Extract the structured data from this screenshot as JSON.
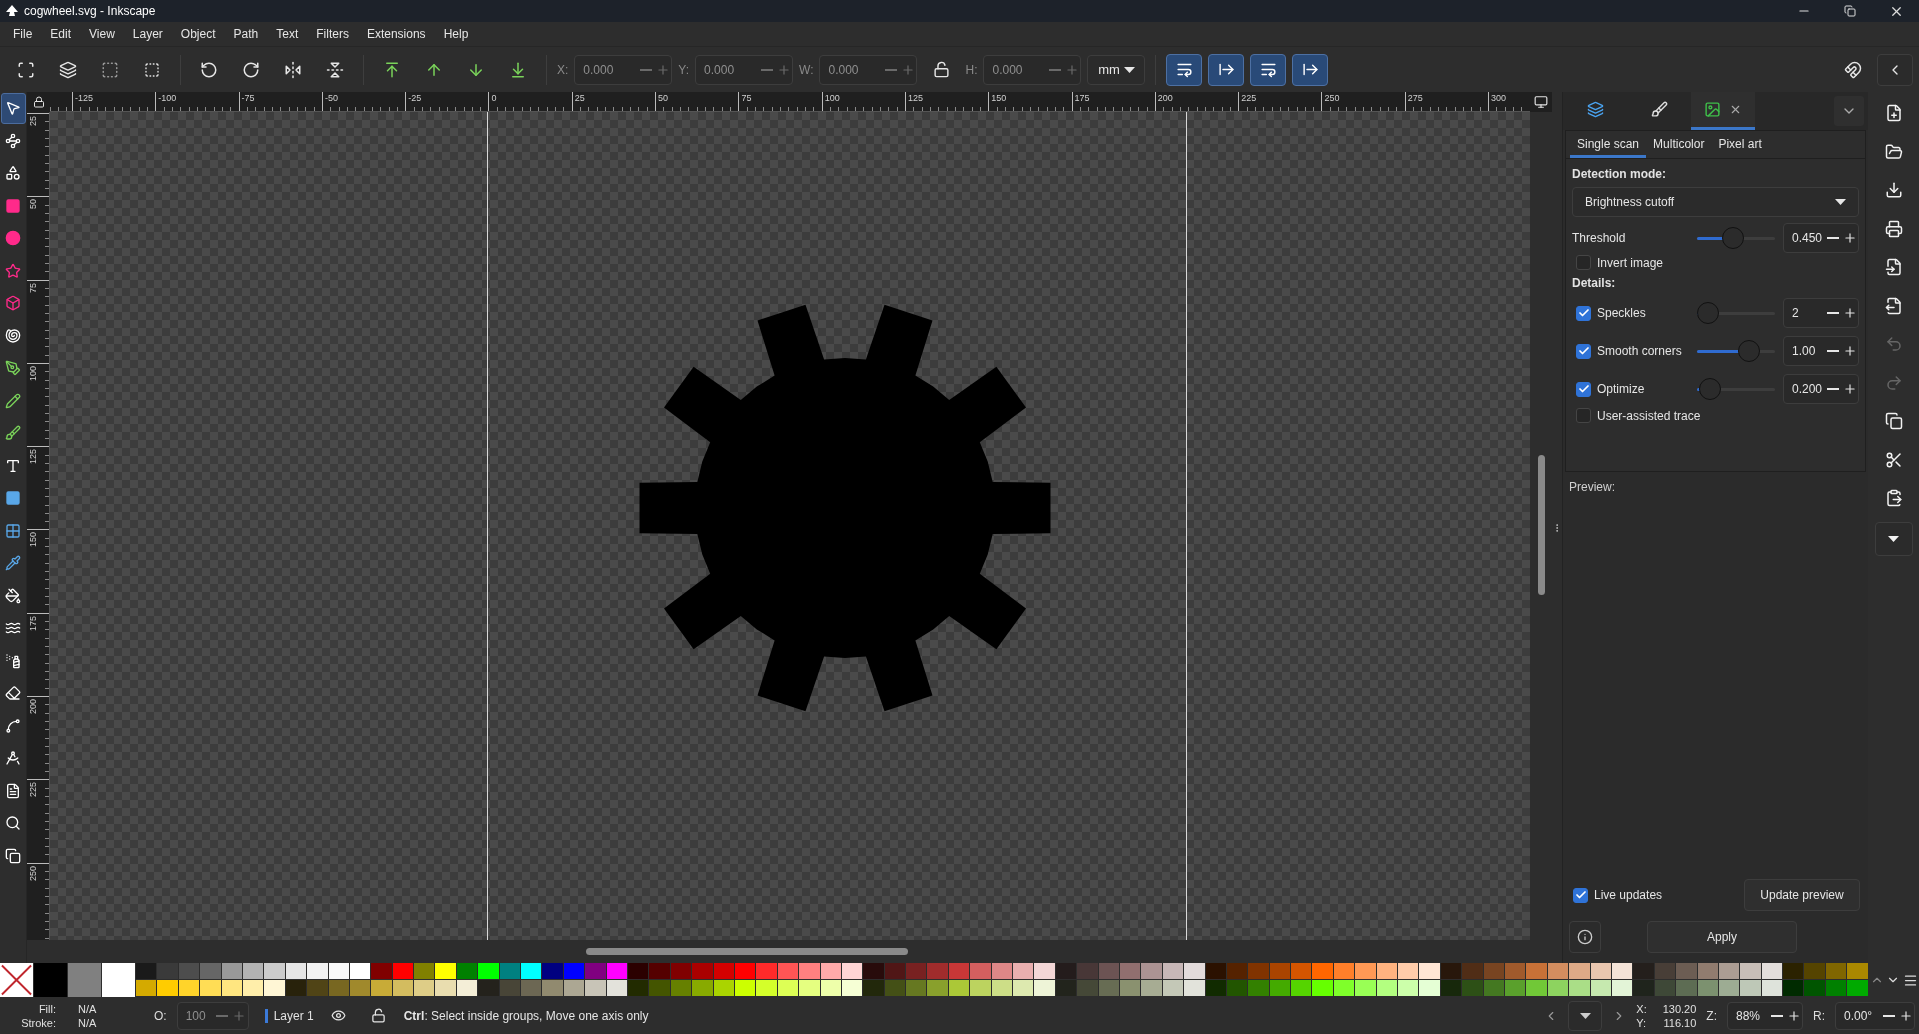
{
  "window": {
    "title": "cogwheel.svg - Inkscape"
  },
  "menu": [
    "File",
    "Edit",
    "View",
    "Layer",
    "Object",
    "Path",
    "Text",
    "Filters",
    "Extensions",
    "Help"
  ],
  "toolbar": {
    "items": [
      {
        "kind": "field",
        "label": "X:",
        "value": "0.000"
      },
      {
        "kind": "field",
        "label": "Y:",
        "value": "0.000"
      },
      {
        "kind": "field",
        "label": "W:",
        "value": "0.000"
      },
      {
        "kind": "lock"
      },
      {
        "kind": "field",
        "label": "H:",
        "value": "0.000"
      }
    ],
    "unit": "mm",
    "toggles": [
      {
        "on": true
      },
      {
        "on": true
      },
      {
        "on": true
      },
      {
        "on": true
      }
    ]
  },
  "tools": [
    {
      "kind": "select",
      "selected": true
    },
    {
      "kind": "node",
      "selected": false
    },
    {
      "kind": "shape-builder",
      "selected": false
    },
    {
      "kind": "rect",
      "selected": false
    },
    {
      "kind": "ellipse",
      "selected": false
    },
    {
      "kind": "star",
      "selected": false
    },
    {
      "kind": "box3d",
      "selected": false
    },
    {
      "kind": "spiral",
      "selected": false
    },
    {
      "kind": "pen",
      "selected": false
    },
    {
      "kind": "pencil",
      "selected": false
    },
    {
      "kind": "calligraphy",
      "selected": false
    },
    {
      "kind": "text",
      "selected": false
    },
    {
      "kind": "gradient",
      "selected": false
    },
    {
      "kind": "mesh",
      "selected": false
    },
    {
      "kind": "dropper",
      "selected": false
    },
    {
      "kind": "bucket",
      "selected": false
    },
    {
      "kind": "tweak",
      "selected": false
    },
    {
      "kind": "spray",
      "selected": false
    },
    {
      "kind": "eraser",
      "selected": false
    },
    {
      "kind": "connector",
      "selected": false
    },
    {
      "kind": "measure",
      "selected": false
    },
    {
      "kind": "document",
      "selected": false
    },
    {
      "kind": "zoom",
      "selected": false
    },
    {
      "kind": "pages",
      "selected": false
    }
  ],
  "ruler": {
    "horizontal": [
      "-125",
      "-100",
      "-75",
      "-50",
      "-25",
      "0",
      "25",
      "50",
      "75",
      "100",
      "125",
      "150",
      "175",
      "200",
      "225",
      "250",
      "275",
      "300"
    ],
    "vertical": [
      "25",
      "50",
      "75",
      "100",
      "125",
      "150",
      "175",
      "200",
      "225",
      "250"
    ]
  },
  "dock": {
    "tabs": [
      {
        "kind": "layers",
        "selected": false
      },
      {
        "kind": "fill",
        "selected": false
      },
      {
        "kind": "trace",
        "selected": true
      }
    ],
    "trace": {
      "subtabs": [
        {
          "label": "Single scan",
          "selected": true
        },
        {
          "label": "Multicolor",
          "selected": false
        },
        {
          "label": "Pixel art",
          "selected": false
        }
      ],
      "detection_label": "Detection mode:",
      "mode": "Brightness cutoff",
      "threshold": {
        "label": "Threshold",
        "level": 0.44,
        "value": "0.450"
      },
      "invert": {
        "label": "Invert image",
        "checked": false
      },
      "details_label": "Details:",
      "options": [
        {
          "label": "Speckles",
          "checked": true,
          "level": 0.0,
          "value": "2"
        },
        {
          "label": "Smooth corners",
          "checked": true,
          "level": 0.73,
          "value": "1.00"
        },
        {
          "label": "Optimize",
          "checked": true,
          "level": 0.03,
          "value": "0.200"
        }
      ],
      "user_assisted": {
        "label": "User-assisted trace",
        "checked": false
      },
      "preview_label": "Preview:",
      "live_updates": {
        "label": "Live updates",
        "checked": true
      },
      "update_button": "Update preview",
      "apply_button": "Apply"
    }
  },
  "commands": [
    {
      "kind": "new",
      "disabled": false
    },
    {
      "kind": "open",
      "disabled": false
    },
    {
      "kind": "save",
      "disabled": false
    },
    {
      "kind": "print",
      "disabled": false
    },
    {
      "kind": "import",
      "disabled": false
    },
    {
      "kind": "export",
      "disabled": false
    },
    {
      "kind": "undo",
      "disabled": true
    },
    {
      "kind": "redo",
      "disabled": true
    },
    {
      "kind": "duplicate",
      "disabled": false
    },
    {
      "kind": "cut",
      "disabled": false
    },
    {
      "kind": "paste",
      "disabled": false
    },
    {
      "kind": "more",
      "disabled": false
    }
  ],
  "palette": {
    "large": [
      {
        "kind": "none"
      },
      {
        "kind": "color",
        "color": "#000000"
      },
      {
        "kind": "color",
        "color": "#808080"
      },
      {
        "kind": "color",
        "color": "#ffffff"
      }
    ],
    "top": [
      {
        "color": "#1a1a1a"
      },
      {
        "color": "#3a3a3a"
      },
      {
        "color": "#4d4d4d"
      },
      {
        "color": "#666666"
      },
      {
        "color": "#999999"
      },
      {
        "color": "#b3b3b3"
      },
      {
        "color": "#cccccc"
      },
      {
        "color": "#e6e6e6"
      },
      {
        "color": "#f2f2f2"
      },
      {
        "color": "#f9f9f9"
      },
      {
        "color": "#ffffff"
      },
      {
        "color": "#800000"
      },
      {
        "color": "#ff0000"
      },
      {
        "color": "#808000"
      },
      {
        "color": "#ffff00"
      },
      {
        "color": "#008000"
      },
      {
        "color": "#00ff00"
      },
      {
        "color": "#008080"
      },
      {
        "color": "#00ffff"
      },
      {
        "color": "#000080"
      },
      {
        "color": "#0000ff"
      },
      {
        "color": "#800080"
      },
      {
        "color": "#ff00ff"
      },
      {
        "color": "#2b0000"
      },
      {
        "color": "#550000"
      },
      {
        "color": "#800001"
      },
      {
        "color": "#aa0000"
      },
      {
        "color": "#d40000"
      },
      {
        "color": "#ff0001"
      },
      {
        "color": "#ff2a2a"
      },
      {
        "color": "#ff5555"
      },
      {
        "color": "#ff8080"
      },
      {
        "color": "#ffaaaa"
      },
      {
        "color": "#ffd5d5"
      },
      {
        "color": "#280b0b"
      },
      {
        "color": "#501616"
      },
      {
        "color": "#782121"
      },
      {
        "color": "#a02c2c"
      },
      {
        "color": "#c83737"
      },
      {
        "color": "#d35f5f"
      },
      {
        "color": "#de8787"
      },
      {
        "color": "#e9afaf"
      },
      {
        "color": "#f4d7d7"
      },
      {
        "color": "#241c1c"
      },
      {
        "color": "#483737"
      },
      {
        "color": "#6c5353"
      },
      {
        "color": "#916f6f"
      },
      {
        "color": "#ac9393"
      },
      {
        "color": "#c8b7b7"
      },
      {
        "color": "#e3dbdb"
      },
      {
        "color": "#2b1100"
      },
      {
        "color": "#552200"
      },
      {
        "color": "#803300"
      },
      {
        "color": "#aa4400"
      },
      {
        "color": "#d45500"
      },
      {
        "color": "#ff6600"
      },
      {
        "color": "#ff7f2a"
      },
      {
        "color": "#ff9955"
      },
      {
        "color": "#ffb380"
      },
      {
        "color": "#ffccaa"
      },
      {
        "color": "#ffe6d5"
      },
      {
        "color": "#28170b"
      },
      {
        "color": "#502d16"
      },
      {
        "color": "#784421"
      },
      {
        "color": "#a05a2c"
      },
      {
        "color": "#c87137"
      },
      {
        "color": "#d38d5f"
      },
      {
        "color": "#deaa87"
      },
      {
        "color": "#e9c6af"
      },
      {
        "color": "#f4e3d7"
      },
      {
        "color": "#241f1c"
      },
      {
        "color": "#483e37"
      },
      {
        "color": "#6c5d53"
      },
      {
        "color": "#917c6f"
      },
      {
        "color": "#ac9d93"
      },
      {
        "color": "#c8beb7"
      },
      {
        "color": "#e3dedb"
      },
      {
        "color": "#2b2200"
      },
      {
        "color": "#554400"
      },
      {
        "color": "#806600"
      },
      {
        "color": "#aa8800"
      }
    ],
    "bottom": [
      {
        "color": "#d4aa00"
      },
      {
        "color": "#ffcc00"
      },
      {
        "color": "#ffd42a"
      },
      {
        "color": "#ffdd55"
      },
      {
        "color": "#ffe680"
      },
      {
        "color": "#ffeeaa"
      },
      {
        "color": "#fff6d5"
      },
      {
        "color": "#28220b"
      },
      {
        "color": "#504416"
      },
      {
        "color": "#786721"
      },
      {
        "color": "#a0892c"
      },
      {
        "color": "#c8ab37"
      },
      {
        "color": "#d3bc5f"
      },
      {
        "color": "#decd87"
      },
      {
        "color": "#e9ddaf"
      },
      {
        "color": "#f4eed7"
      },
      {
        "color": "#24221c"
      },
      {
        "color": "#484537"
      },
      {
        "color": "#6c6753"
      },
      {
        "color": "#918a6f"
      },
      {
        "color": "#aca793"
      },
      {
        "color": "#c8c4b7"
      },
      {
        "color": "#e3e2db"
      },
      {
        "color": "#222b00"
      },
      {
        "color": "#445500"
      },
      {
        "color": "#668000"
      },
      {
        "color": "#88aa00"
      },
      {
        "color": "#aad400"
      },
      {
        "color": "#ccff00"
      },
      {
        "color": "#d4ff2a"
      },
      {
        "color": "#ddff55"
      },
      {
        "color": "#e5ff80"
      },
      {
        "color": "#eeffaa"
      },
      {
        "color": "#f6ffd5"
      },
      {
        "color": "#22280b"
      },
      {
        "color": "#445016"
      },
      {
        "color": "#667821"
      },
      {
        "color": "#89a02c"
      },
      {
        "color": "#abc837"
      },
      {
        "color": "#bcd35f"
      },
      {
        "color": "#cdde87"
      },
      {
        "color": "#dde9af"
      },
      {
        "color": "#eef4d7"
      },
      {
        "color": "#22241c"
      },
      {
        "color": "#454837"
      },
      {
        "color": "#676c53"
      },
      {
        "color": "#8a916f"
      },
      {
        "color": "#a7ac93"
      },
      {
        "color": "#c4c8b7"
      },
      {
        "color": "#e2e3db"
      },
      {
        "color": "#112b00"
      },
      {
        "color": "#225500"
      },
      {
        "color": "#338000"
      },
      {
        "color": "#44aa00"
      },
      {
        "color": "#55d400"
      },
      {
        "color": "#66ff00"
      },
      {
        "color": "#7fff2a"
      },
      {
        "color": "#99ff55"
      },
      {
        "color": "#b3ff80"
      },
      {
        "color": "#ccffaa"
      },
      {
        "color": "#e5ffd5"
      },
      {
        "color": "#17280b"
      },
      {
        "color": "#2d5016"
      },
      {
        "color": "#447821"
      },
      {
        "color": "#5aa02c"
      },
      {
        "color": "#71c837"
      },
      {
        "color": "#8dd35f"
      },
      {
        "color": "#aade87"
      },
      {
        "color": "#c6e9af"
      },
      {
        "color": "#e3f4d7"
      },
      {
        "color": "#1f241c"
      },
      {
        "color": "#3e4837"
      },
      {
        "color": "#5d6c53"
      },
      {
        "color": "#7c916f"
      },
      {
        "color": "#9dac93"
      },
      {
        "color": "#bec8b7"
      },
      {
        "color": "#dee3db"
      },
      {
        "color": "#002b00"
      },
      {
        "color": "#005500"
      },
      {
        "color": "#008000"
      },
      {
        "color": "#00aa00"
      }
    ]
  },
  "status": {
    "fill_label": "Fill:",
    "fill_value": "N/A",
    "stroke_label": "Stroke:",
    "stroke_value": "N/A",
    "opacity_label": "O:",
    "opacity_value": "100",
    "layer": "Layer 1",
    "message": "**Ctrl**: Select inside groups, Move one axis only",
    "x_label": "X:",
    "x_value": "130.20",
    "y_label": "Y:",
    "y_value": "116.10",
    "zoom_label": "Z:",
    "zoom_value": "88%",
    "rotation_label": "R:",
    "rotation_value": "0.00°"
  }
}
